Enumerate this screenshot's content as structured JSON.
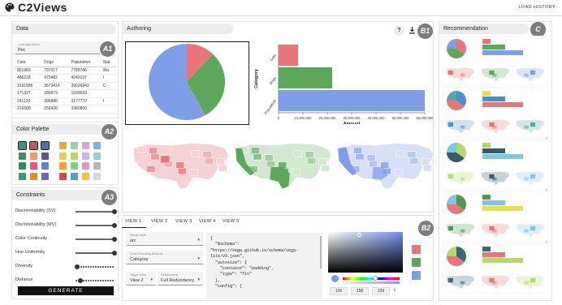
{
  "app": {
    "title": "C2Views",
    "load_history": "LOAD HISTORY"
  },
  "data_panel": {
    "title": "Data",
    "badge": "A1",
    "source_label": "Load data source",
    "source_value": "Pet",
    "columns": [
      "Cats",
      "Dogs",
      "Population",
      "Stat"
    ],
    "rows": [
      [
        "851983",
        "797017",
        "7785786",
        "Wa"
      ],
      [
        "486218",
        "470482",
        "4240137",
        "I"
      ],
      [
        "3191586",
        "3673414",
        "39029342",
        "C"
      ],
      [
        "171327",
        "180673",
        "1939033",
        ""
      ],
      [
        "241120",
        "306880",
        "3177772",
        "I"
      ],
      [
        "216580",
        "259420",
        "3380800",
        ""
      ]
    ]
  },
  "palette_panel": {
    "title": "Color Palette",
    "badge": "A2",
    "swatches": [
      "#4a8d7a",
      "#c45b5b",
      "#4f6fa8",
      "#e6a93a",
      "#9bcfb3",
      "#d8a6c8",
      "#7fb3d5",
      "#3f8c6a",
      "#f09a6a",
      "#5a5a8a",
      "#e9c75c",
      "#b6d66b",
      "#c9b6e4",
      "#9ccfcf",
      "#2e8b57",
      "#e4577a",
      "#5a87c8",
      "#f3a13a",
      "#7fcf8a",
      "#e29ab8",
      "#b5b5b5",
      "#3a9a7a",
      "#e88a2a",
      "#6a6ab8",
      "#d94a4a",
      "#4a9fd8",
      "#f5c23a",
      "#d9d9d9"
    ]
  },
  "constraints_panel": {
    "title": "Constraints",
    "badge": "A3",
    "sliders": [
      {
        "label": "Discriminability (SV)",
        "value": 1.0
      },
      {
        "label": "Discriminability (MV)",
        "value": 1.0
      },
      {
        "label": "Color Continuity",
        "value": 1.0
      },
      {
        "label": "Hue Uniformity",
        "value": 1.0
      },
      {
        "label": "Diversity",
        "value": 0.05
      },
      {
        "label": "Distance",
        "value": 0.12
      }
    ],
    "generate_label": "GENERATE"
  },
  "authoring_panel": {
    "title": "Authoring",
    "badge": "B1",
    "help_icon": "?",
    "download_icon": "download-icon",
    "bar_chart": {
      "type": "bar",
      "ylabel": "Category",
      "xlabel": "Amount",
      "categories": [
        "Cats",
        "Dogs",
        "Population"
      ],
      "values": [
        8000000,
        22000000,
        60000000
      ],
      "colors": [
        "#e8757a",
        "#5ba85a",
        "#7f9ee8"
      ],
      "ticks": [
        "0",
        "10,000,000",
        "20,000,000",
        "30,000,000",
        "40,000,000",
        "50,000,000",
        "60,000,000"
      ],
      "xlim": [
        0,
        60000000
      ]
    },
    "pie_chart": {
      "type": "pie",
      "values": [
        12,
        30,
        58
      ],
      "colors": [
        "#e8757a",
        "#5ba85a",
        "#7f9ee8"
      ]
    },
    "maps": [
      {
        "color": "#e8757a",
        "light": "#f5d3d4"
      },
      {
        "color": "#5ba85a",
        "light": "#d2e8d1"
      },
      {
        "color": "#7f9ee8",
        "light": "#d7e0f7"
      }
    ]
  },
  "editor_panel": {
    "badge": "B2",
    "tabs": [
      "VIEW 1",
      "VIEW 2",
      "VIEW 3",
      "VIEW 4",
      "VIEW 5"
    ],
    "visual_mark": {
      "label": "Visual mark",
      "value": "arc"
    },
    "color_encoding": {
      "label": "Color Encoding Attribute",
      "value": "Category"
    },
    "target_view": {
      "label": "Target View",
      "value": "View 2"
    },
    "relationship": {
      "label": "Relationship",
      "value": "Full Redundancy"
    },
    "code": "{\n  \"$schema\":\n\"https://vega.github.io/schema/vega-\nlite/v5.json\",\n  \"autosize\": {\n    \"contains\": \"padding\",\n    \"type\": \"fit\"\n  },\n  \"config\": {",
    "picker": {
      "r": "126",
      "g": "158",
      "b": "229"
    },
    "selected_colors": [
      "#e8757a",
      "#5ba85a",
      "#7f9ee8"
    ]
  },
  "recommendation_panel": {
    "title": "Recommendation",
    "badge": "C",
    "items": [
      {
        "pie": [
          "#e8757a",
          "#5ba85a",
          "#7f9ee8"
        ],
        "bars": [
          "#e8757a",
          "#5ba85a",
          "#7f9ee8"
        ]
      },
      {
        "pie": [
          "#4a8fd0",
          "#e8757a",
          "#5aa7a0"
        ],
        "bars": [
          "#e8e04a",
          "#4a8fd0",
          "#e8757a"
        ]
      },
      {
        "pie": [
          "#b5d96a",
          "#3a5a6a",
          "#7ec6e8"
        ],
        "bars": [
          "#b5d96a",
          "#3a5a6a",
          "#7ec6e8"
        ]
      },
      {
        "pie": [
          "#4f9a4f",
          "#e8757a",
          "#7fc3e8"
        ],
        "bars": [
          "#4f9a4f",
          "#7fc3e8",
          "#e8e04a"
        ]
      },
      {
        "pie": [
          "#3a6a7a",
          "#e8757a",
          "#b5d96a"
        ],
        "bars": [
          "#3a6a7a",
          "#e8757a",
          "#b5d96a"
        ]
      }
    ]
  }
}
